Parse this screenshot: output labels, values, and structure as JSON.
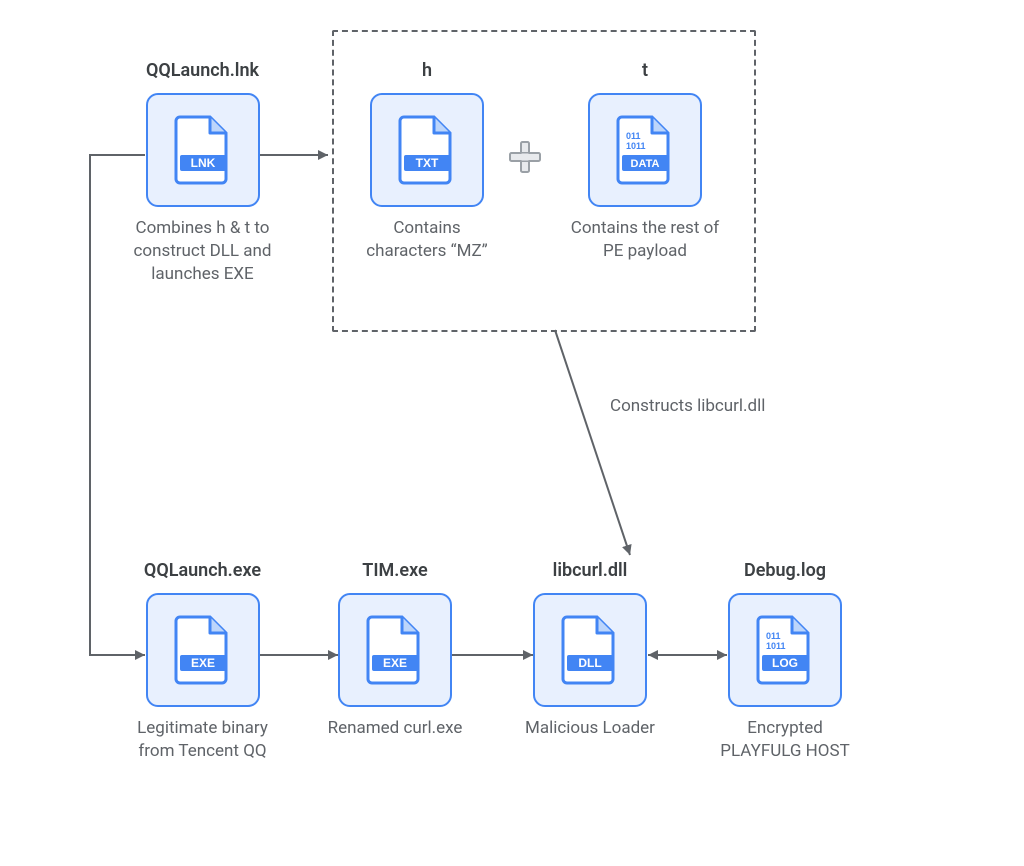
{
  "nodes": {
    "lnk": {
      "title": "QQLaunch.lnk",
      "desc": "Combines h & t to construct DLL and launches EXE",
      "badge": "LNK"
    },
    "h": {
      "title": "h",
      "desc": "Contains characters “MZ”",
      "badge": "TXT"
    },
    "t": {
      "title": "t",
      "desc": "Contains the rest of PE payload",
      "badge": "DATA",
      "binary": true
    },
    "qqexe": {
      "title": "QQLaunch.exe",
      "desc": "Legitimate binary from Tencent QQ",
      "badge": "EXE"
    },
    "tim": {
      "title": "TIM.exe",
      "desc": "Renamed curl.exe",
      "badge": "EXE"
    },
    "dll": {
      "title": "libcurl.dll",
      "desc": "Malicious Loader",
      "badge": "DLL"
    },
    "log": {
      "title": "Debug.log",
      "desc": "Encrypted PLAYFULG HOST",
      "badge": "LOG",
      "binary": true
    }
  },
  "annotations": {
    "constructs": "Constructs libcurl.dll"
  },
  "chart_data": {
    "type": "flowchart",
    "nodes": [
      {
        "id": "lnk",
        "file": "QQLaunch.lnk",
        "kind": "LNK",
        "note": "Combines h & t to construct DLL and launches EXE"
      },
      {
        "id": "h",
        "file": "h",
        "kind": "TXT",
        "note": "Contains characters \"MZ\""
      },
      {
        "id": "t",
        "file": "t",
        "kind": "DATA",
        "note": "Contains the rest of PE payload"
      },
      {
        "id": "qqexe",
        "file": "QQLaunch.exe",
        "kind": "EXE",
        "note": "Legitimate binary from Tencent QQ"
      },
      {
        "id": "tim",
        "file": "TIM.exe",
        "kind": "EXE",
        "note": "Renamed curl.exe"
      },
      {
        "id": "dll",
        "file": "libcurl.dll",
        "kind": "DLL",
        "note": "Malicious Loader"
      },
      {
        "id": "log",
        "file": "Debug.log",
        "kind": "LOG",
        "note": "Encrypted PLAYFULGHOST"
      }
    ],
    "groups": [
      {
        "id": "ht",
        "members": [
          "h",
          "t"
        ],
        "operation": "concat",
        "produces": "libcurl.dll"
      }
    ],
    "edges": [
      {
        "from": "lnk",
        "to": "ht",
        "direction": "forward"
      },
      {
        "from": "ht",
        "to": "dll",
        "direction": "forward",
        "label": "Constructs libcurl.dll"
      },
      {
        "from": "lnk",
        "to": "qqexe",
        "direction": "forward"
      },
      {
        "from": "qqexe",
        "to": "tim",
        "direction": "forward"
      },
      {
        "from": "tim",
        "to": "dll",
        "direction": "forward"
      },
      {
        "from": "dll",
        "to": "log",
        "direction": "both"
      }
    ]
  }
}
